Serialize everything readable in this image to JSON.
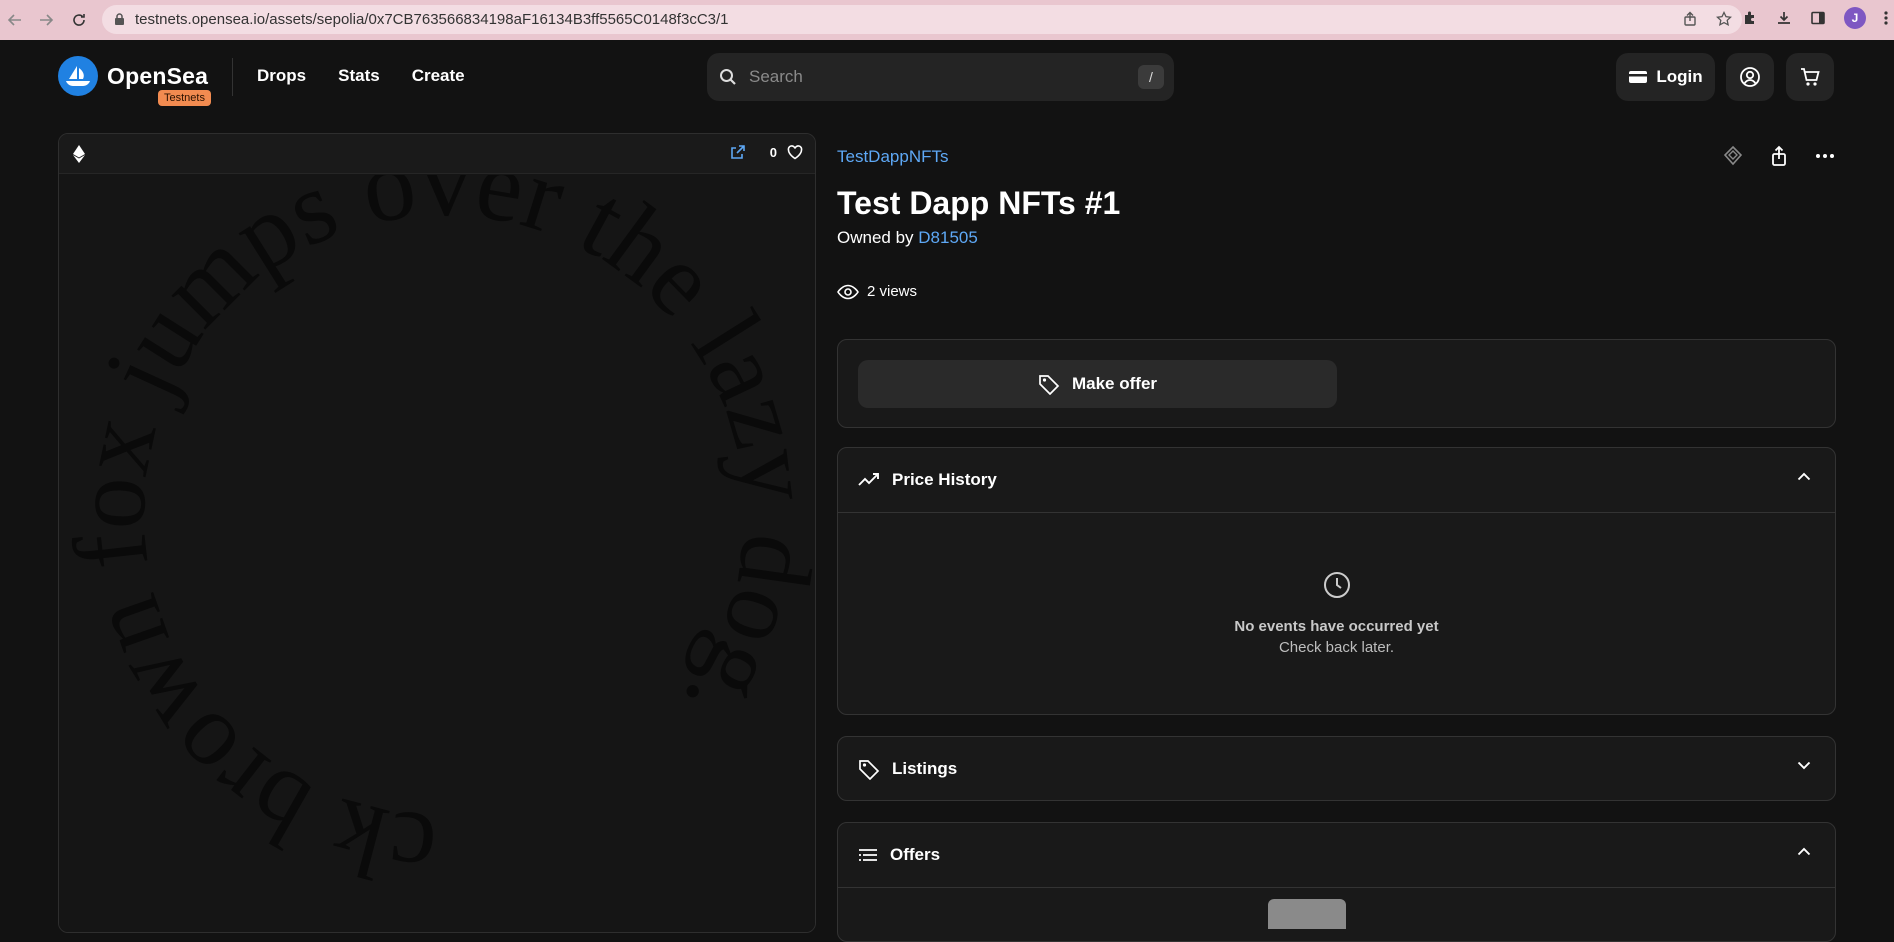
{
  "browser": {
    "url": "testnets.opensea.io/assets/sepolia/0x7CB763566834198aF16134B3ff5565C0148f3cC3/1",
    "profile_initial": "J",
    "icons": [
      "back-arrow-icon",
      "forward-arrow-icon",
      "reload-icon",
      "lock-icon",
      "share-icon",
      "star-icon",
      "extensions-icon",
      "download-icon",
      "sidepanel-icon",
      "kebab-menu-icon"
    ]
  },
  "header": {
    "brand": "OpenSea",
    "badge": "Testnets",
    "nav": [
      "Drops",
      "Stats",
      "Create"
    ],
    "search_placeholder": "Search",
    "search_shortcut": "/",
    "login_label": "Login"
  },
  "media": {
    "favorite_count": "0",
    "art_text": "Quick brown fox jumps over the lazy dog."
  },
  "asset": {
    "collection": "TestDappNFTs",
    "title": "Test Dapp NFTs #1",
    "owned_by_label": "Owned by",
    "owner": "D81505",
    "views": "2 views"
  },
  "actions": {
    "make_offer_label": "Make offer"
  },
  "sections": {
    "price_history": {
      "label": "Price History",
      "empty_title": "No events have occurred yet",
      "empty_sub": "Check back later."
    },
    "listings": {
      "label": "Listings"
    },
    "offers": {
      "label": "Offers"
    }
  },
  "colors": {
    "accent_blue": "#2081e2",
    "link_blue": "#5ea8f5",
    "badge_orange": "#f28b50",
    "background": "#121212",
    "chrome": "#e9c6cf"
  }
}
